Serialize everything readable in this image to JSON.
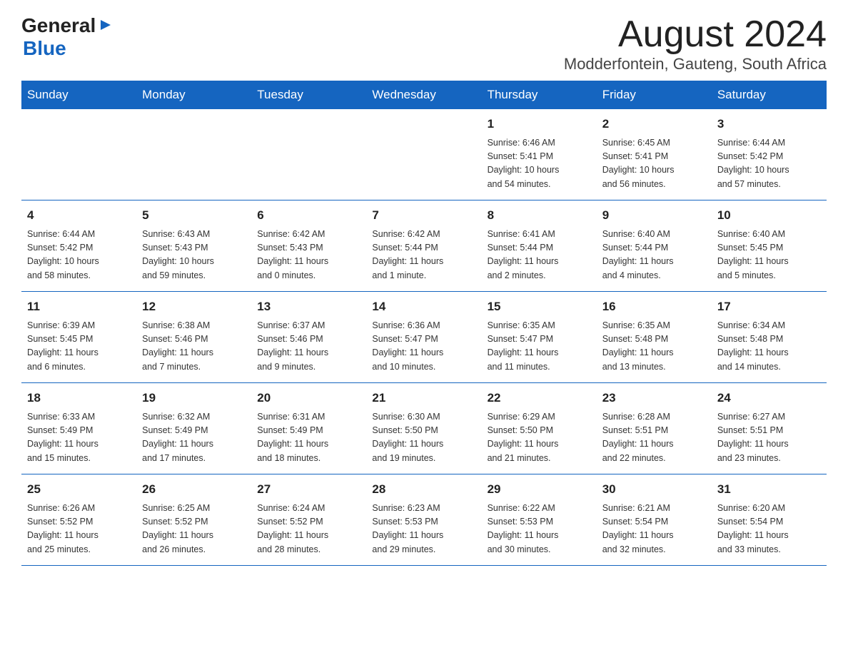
{
  "header": {
    "logo_general": "General",
    "logo_blue": "Blue",
    "month_title": "August 2024",
    "location": "Modderfontein, Gauteng, South Africa"
  },
  "weekdays": [
    "Sunday",
    "Monday",
    "Tuesday",
    "Wednesday",
    "Thursday",
    "Friday",
    "Saturday"
  ],
  "weeks": [
    [
      {
        "day": "",
        "info": ""
      },
      {
        "day": "",
        "info": ""
      },
      {
        "day": "",
        "info": ""
      },
      {
        "day": "",
        "info": ""
      },
      {
        "day": "1",
        "info": "Sunrise: 6:46 AM\nSunset: 5:41 PM\nDaylight: 10 hours\nand 54 minutes."
      },
      {
        "day": "2",
        "info": "Sunrise: 6:45 AM\nSunset: 5:41 PM\nDaylight: 10 hours\nand 56 minutes."
      },
      {
        "day": "3",
        "info": "Sunrise: 6:44 AM\nSunset: 5:42 PM\nDaylight: 10 hours\nand 57 minutes."
      }
    ],
    [
      {
        "day": "4",
        "info": "Sunrise: 6:44 AM\nSunset: 5:42 PM\nDaylight: 10 hours\nand 58 minutes."
      },
      {
        "day": "5",
        "info": "Sunrise: 6:43 AM\nSunset: 5:43 PM\nDaylight: 10 hours\nand 59 minutes."
      },
      {
        "day": "6",
        "info": "Sunrise: 6:42 AM\nSunset: 5:43 PM\nDaylight: 11 hours\nand 0 minutes."
      },
      {
        "day": "7",
        "info": "Sunrise: 6:42 AM\nSunset: 5:44 PM\nDaylight: 11 hours\nand 1 minute."
      },
      {
        "day": "8",
        "info": "Sunrise: 6:41 AM\nSunset: 5:44 PM\nDaylight: 11 hours\nand 2 minutes."
      },
      {
        "day": "9",
        "info": "Sunrise: 6:40 AM\nSunset: 5:44 PM\nDaylight: 11 hours\nand 4 minutes."
      },
      {
        "day": "10",
        "info": "Sunrise: 6:40 AM\nSunset: 5:45 PM\nDaylight: 11 hours\nand 5 minutes."
      }
    ],
    [
      {
        "day": "11",
        "info": "Sunrise: 6:39 AM\nSunset: 5:45 PM\nDaylight: 11 hours\nand 6 minutes."
      },
      {
        "day": "12",
        "info": "Sunrise: 6:38 AM\nSunset: 5:46 PM\nDaylight: 11 hours\nand 7 minutes."
      },
      {
        "day": "13",
        "info": "Sunrise: 6:37 AM\nSunset: 5:46 PM\nDaylight: 11 hours\nand 9 minutes."
      },
      {
        "day": "14",
        "info": "Sunrise: 6:36 AM\nSunset: 5:47 PM\nDaylight: 11 hours\nand 10 minutes."
      },
      {
        "day": "15",
        "info": "Sunrise: 6:35 AM\nSunset: 5:47 PM\nDaylight: 11 hours\nand 11 minutes."
      },
      {
        "day": "16",
        "info": "Sunrise: 6:35 AM\nSunset: 5:48 PM\nDaylight: 11 hours\nand 13 minutes."
      },
      {
        "day": "17",
        "info": "Sunrise: 6:34 AM\nSunset: 5:48 PM\nDaylight: 11 hours\nand 14 minutes."
      }
    ],
    [
      {
        "day": "18",
        "info": "Sunrise: 6:33 AM\nSunset: 5:49 PM\nDaylight: 11 hours\nand 15 minutes."
      },
      {
        "day": "19",
        "info": "Sunrise: 6:32 AM\nSunset: 5:49 PM\nDaylight: 11 hours\nand 17 minutes."
      },
      {
        "day": "20",
        "info": "Sunrise: 6:31 AM\nSunset: 5:49 PM\nDaylight: 11 hours\nand 18 minutes."
      },
      {
        "day": "21",
        "info": "Sunrise: 6:30 AM\nSunset: 5:50 PM\nDaylight: 11 hours\nand 19 minutes."
      },
      {
        "day": "22",
        "info": "Sunrise: 6:29 AM\nSunset: 5:50 PM\nDaylight: 11 hours\nand 21 minutes."
      },
      {
        "day": "23",
        "info": "Sunrise: 6:28 AM\nSunset: 5:51 PM\nDaylight: 11 hours\nand 22 minutes."
      },
      {
        "day": "24",
        "info": "Sunrise: 6:27 AM\nSunset: 5:51 PM\nDaylight: 11 hours\nand 23 minutes."
      }
    ],
    [
      {
        "day": "25",
        "info": "Sunrise: 6:26 AM\nSunset: 5:52 PM\nDaylight: 11 hours\nand 25 minutes."
      },
      {
        "day": "26",
        "info": "Sunrise: 6:25 AM\nSunset: 5:52 PM\nDaylight: 11 hours\nand 26 minutes."
      },
      {
        "day": "27",
        "info": "Sunrise: 6:24 AM\nSunset: 5:52 PM\nDaylight: 11 hours\nand 28 minutes."
      },
      {
        "day": "28",
        "info": "Sunrise: 6:23 AM\nSunset: 5:53 PM\nDaylight: 11 hours\nand 29 minutes."
      },
      {
        "day": "29",
        "info": "Sunrise: 6:22 AM\nSunset: 5:53 PM\nDaylight: 11 hours\nand 30 minutes."
      },
      {
        "day": "30",
        "info": "Sunrise: 6:21 AM\nSunset: 5:54 PM\nDaylight: 11 hours\nand 32 minutes."
      },
      {
        "day": "31",
        "info": "Sunrise: 6:20 AM\nSunset: 5:54 PM\nDaylight: 11 hours\nand 33 minutes."
      }
    ]
  ]
}
